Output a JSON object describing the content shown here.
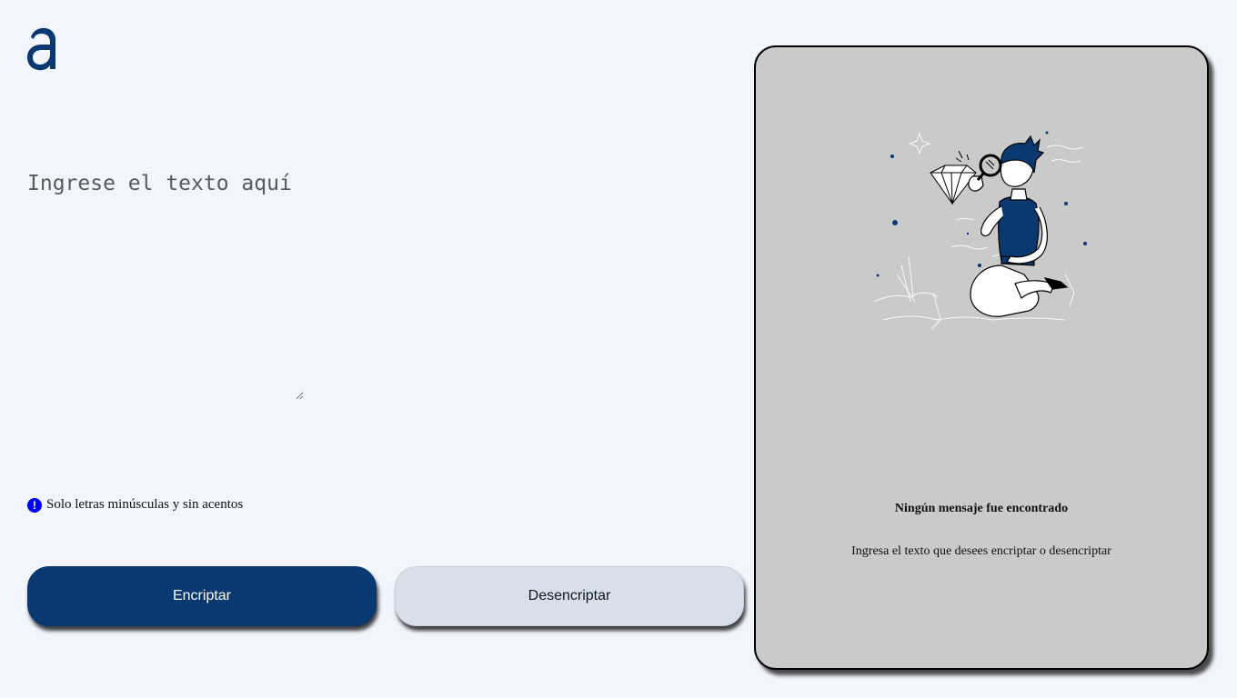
{
  "logo": {
    "icon": "alura-logo-icon",
    "color": "#0a3871"
  },
  "input": {
    "placeholder": "Ingrese el texto aquí",
    "value": ""
  },
  "hint": {
    "icon": "exclamation-circle-icon",
    "text": "Solo letras minúsculas y sin acentos",
    "icon_color": "#0000ff"
  },
  "buttons": {
    "encrypt_label": "Encriptar",
    "decrypt_label": "Desencriptar"
  },
  "output_panel": {
    "illustration": "person-with-magnifier-illustration",
    "title": "Ningún mensaje fue encontrado",
    "text": "Ingresa el texto que desees encriptar o desencriptar"
  },
  "colors": {
    "background": "#f3f5fc",
    "accent": "#0a3871",
    "secondary_button": "#d8dfe8",
    "panel": "#cacaca"
  }
}
